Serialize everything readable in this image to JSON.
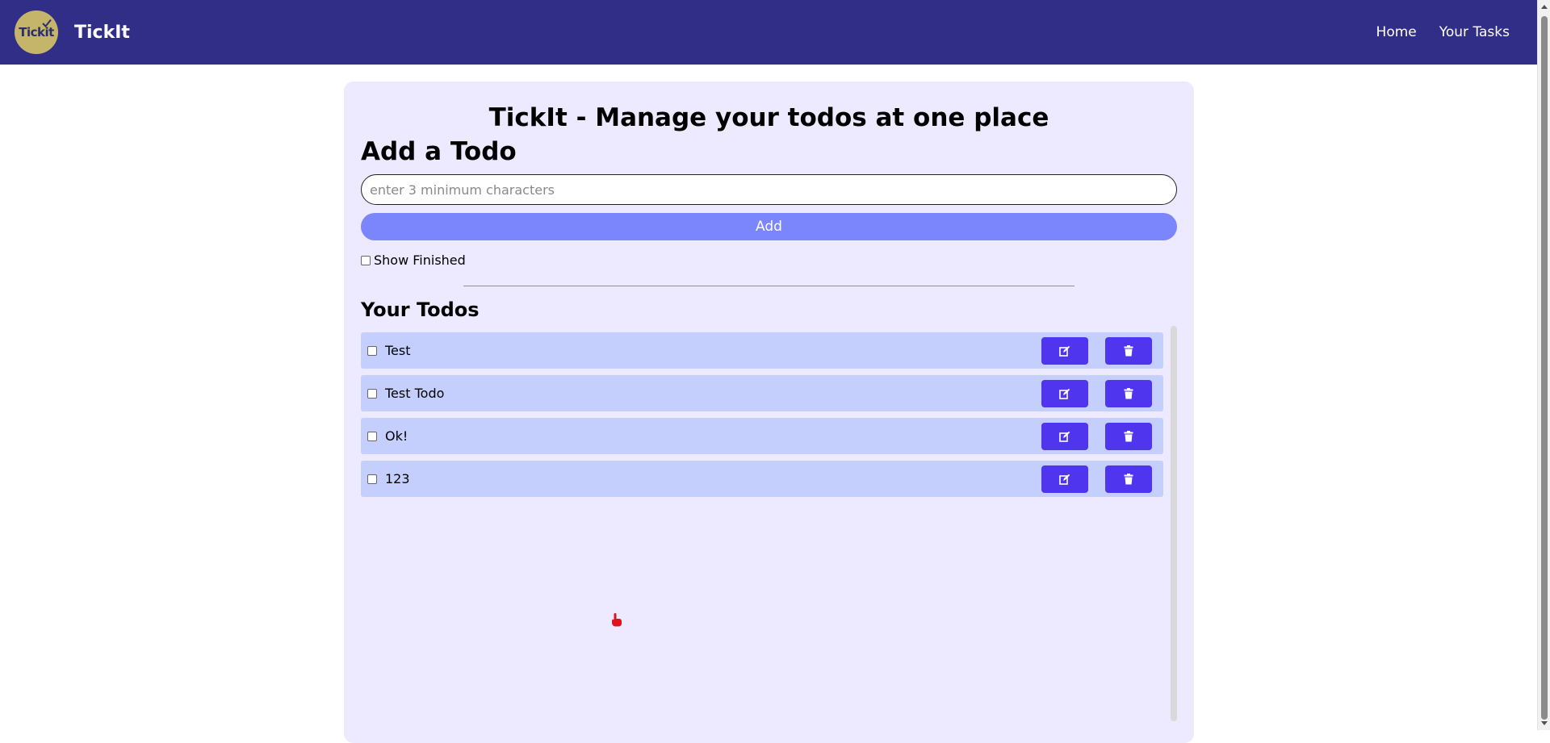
{
  "navbar": {
    "logo_text": "Tickit",
    "brand": "TickIt",
    "links": [
      {
        "label": "Home"
      },
      {
        "label": "Your Tasks"
      }
    ]
  },
  "main": {
    "title": "TickIt - Manage your todos at one place",
    "add_heading": "Add a Todo",
    "input_placeholder": "enter 3 minimum characters",
    "input_value": "",
    "add_label": "Add",
    "show_finished_label": "Show Finished",
    "show_finished_checked": false,
    "todos_heading": "Your Todos",
    "todos": [
      {
        "text": "Test",
        "done": false
      },
      {
        "text": "Test Todo",
        "done": false
      },
      {
        "text": "Ok!",
        "done": false
      },
      {
        "text": "123",
        "done": false
      }
    ]
  },
  "icons": {
    "edit": "edit-icon",
    "delete": "trash-icon",
    "logo_check": "check-icon"
  },
  "colors": {
    "navbar": "#312e87",
    "card": "#ede9fe",
    "add_button": "#7b86fc",
    "todo_row": "#c4cffd",
    "action_button": "#4f35ee",
    "logo": "#c4b56a"
  }
}
